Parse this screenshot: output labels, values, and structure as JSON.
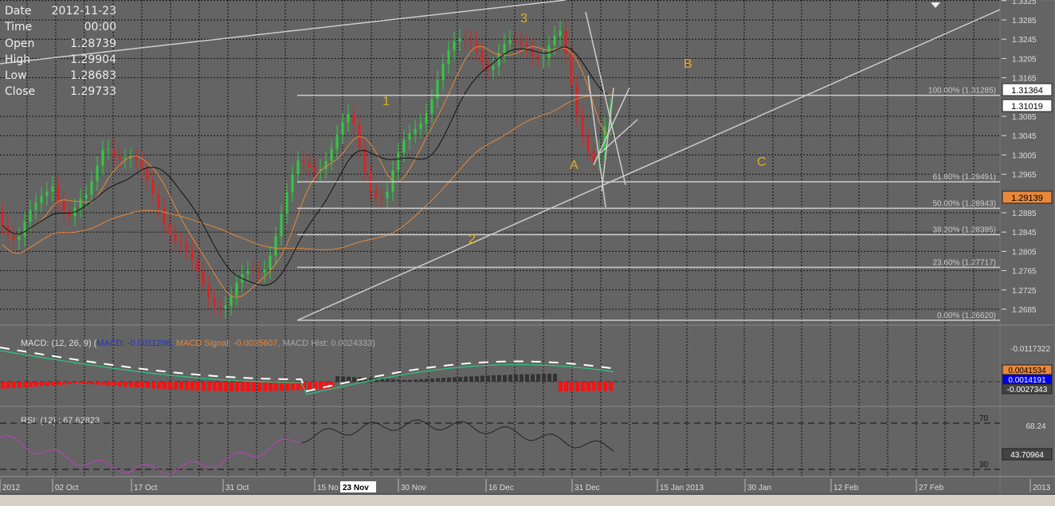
{
  "info": {
    "date_label": "Date",
    "date": "2012-11-23",
    "time_label": "Time",
    "time": "00:00",
    "open_label": "Open",
    "open": "1.28739",
    "high_label": "High",
    "high": "1.29904",
    "low_label": "Low",
    "low": "1.28683",
    "close_label": "Close",
    "close": "1.29733"
  },
  "chart_data": {
    "type": "candlestick",
    "price_axis": {
      "ticks": [
        "1.3325",
        "1.3285",
        "1.3245",
        "1.3205",
        "1.3165",
        "1.3085",
        "1.3045",
        "1.3005",
        "1.2965",
        "1.2885",
        "1.2845",
        "1.2805",
        "1.2765",
        "1.2725",
        "1.2685"
      ],
      "range": [
        1.265,
        1.3325
      ]
    },
    "price_markers": [
      {
        "value": "1.31364",
        "style": "white"
      },
      {
        "value": "1.31019",
        "style": "white"
      },
      {
        "value": "1.29139",
        "style": "orange"
      }
    ],
    "price_path": [
      1.289,
      1.283,
      1.288,
      1.296,
      1.288,
      1.29,
      1.305,
      1.3,
      1.296,
      1.292,
      1.283,
      1.276,
      1.272,
      1.27,
      1.274,
      1.278,
      1.288,
      1.297,
      1.299,
      1.303,
      1.307,
      1.296,
      1.292,
      1.301,
      1.309,
      1.317,
      1.322,
      1.326,
      1.318,
      1.322,
      1.325,
      1.321,
      1.324,
      1.309,
      1.299,
      1.31
    ],
    "fibonacci": [
      {
        "label": "100.00% (1.31285)",
        "value": 1.31285
      },
      {
        "label": "61.80% (1.29491)",
        "value": 1.29491
      },
      {
        "label": "50.00% (1.28943)",
        "value": 1.28943
      },
      {
        "label": "38.20% (1.28395)",
        "value": 1.28395
      },
      {
        "label": "23.60% (1.27717)",
        "value": 1.27717
      },
      {
        "label": "0.00% (1.26620)",
        "value": 1.2662
      }
    ],
    "wave_labels": [
      "1",
      "2",
      "3",
      "A",
      "B",
      "C"
    ],
    "x_axis": {
      "ticks": [
        "2012",
        "02 Oct",
        "17 Oct",
        "31 Oct",
        "15 No",
        "30 Nov",
        "16 Dec",
        "31 Dec",
        "15 Jan 2013",
        "30 Jan",
        "12 Feb",
        "27 Feb",
        "2013"
      ],
      "cursor_label": "23 Nov"
    },
    "macd": {
      "legend_prefix": "MACD: (12, 26, 9) (",
      "macd_label": "MACD: -0.0011298,",
      "signal_label": " MACD Signal: -0.0035607,",
      "hist_label": " MACD Hist: 0.0024333)",
      "axis_top": "-0.0117322",
      "markers": [
        "0.0041534",
        "0.0014191",
        "-0.0027343"
      ]
    },
    "rsi": {
      "legend": "RSI: (12) : 67.62823",
      "levels": [
        "70",
        "30"
      ],
      "axis_value": "68.24",
      "marker": "43.70964"
    }
  },
  "colors": {
    "bg": "#646464",
    "up": "#2ecc40",
    "down": "#e02020",
    "orange": "#e8883a",
    "gold": "#e0b020"
  }
}
